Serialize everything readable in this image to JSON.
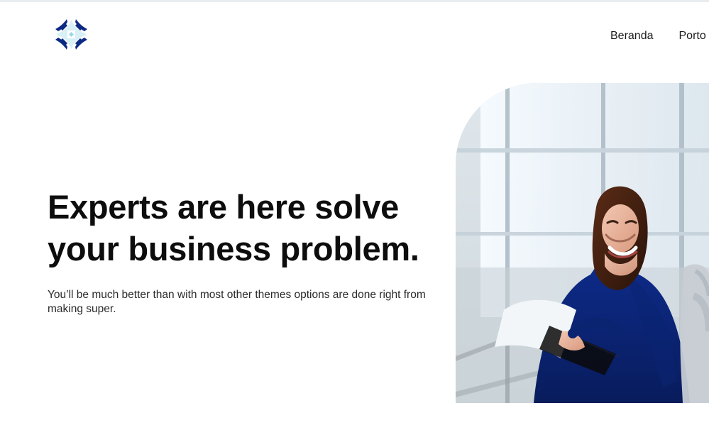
{
  "header": {
    "logo_icon": "four-petal-logo-icon",
    "nav": [
      {
        "label": "Beranda"
      },
      {
        "label": "Porto"
      }
    ]
  },
  "hero": {
    "title_line1": "Experts are here solve",
    "title_line2": "your business problem.",
    "subtitle": "You’ll be much better than with most other themes options are done right from making super.",
    "photo_icon": "businesswoman-office-photo"
  },
  "colors": {
    "brand_dark": "#0b2a84",
    "brand_light": "#63c3dd",
    "text": "#0d0d0d"
  }
}
